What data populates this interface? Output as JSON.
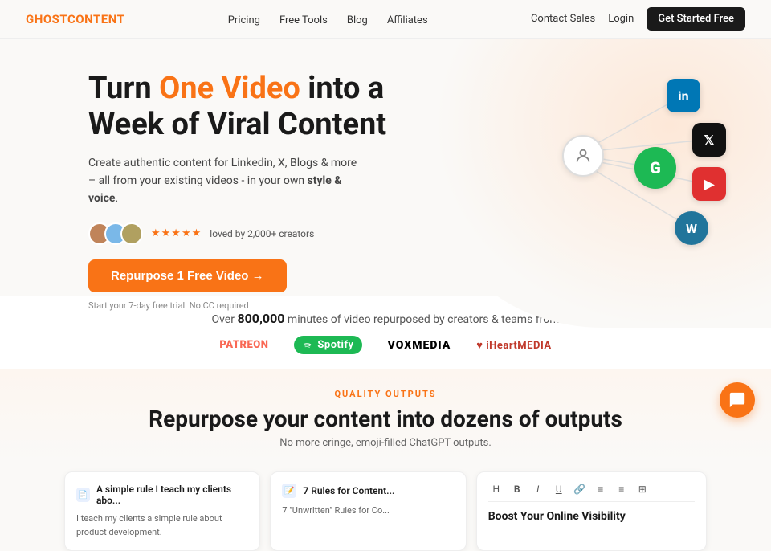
{
  "brand": {
    "logo_ghost": "GHOST",
    "logo_content": "CONTENT"
  },
  "navbar": {
    "pricing": "Pricing",
    "free_tools": "Free Tools",
    "blog": "Blog",
    "affiliates": "Affiliates",
    "contact_sales": "Contact Sales",
    "login": "Login",
    "get_started": "Get Started Free"
  },
  "hero": {
    "title_start": "Turn ",
    "title_highlight": "One Video",
    "title_end": " into a Week of Viral Content",
    "subtitle": "Create authentic content for Linkedin, X, Blogs & more – all from your existing videos - in your own ",
    "subtitle_bold": "style & voice",
    "subtitle_period": ".",
    "stars": "★★★★★",
    "social_proof": "loved by 2,000+ creators",
    "cta_button": "Repurpose 1 Free Video →",
    "trial_text": "Start your 7-day free trial. No CC required"
  },
  "stats": {
    "prefix": "Over ",
    "number": "800,000",
    "suffix": " minutes of video repurposed by creators & teams from"
  },
  "brands": [
    {
      "name": "Patreon",
      "display": "PATREON"
    },
    {
      "name": "Spotify",
      "display": "Spotify"
    },
    {
      "name": "VoxMedia",
      "display": "VOXMEDIA"
    },
    {
      "name": "iHeartMedia",
      "display": "iHeartMEDIA"
    }
  ],
  "quality_section": {
    "label": "QUALITY OUTPUTS",
    "title": "Repurpose your content into dozens of outputs",
    "subtitle": "No more cringe, emoji-filled ChatGPT outputs."
  },
  "cards": [
    {
      "icon": "📄",
      "title": "A simple rule I teach my clients abo...",
      "content": "I teach my clients a simple rule about product development."
    },
    {
      "icon": "📝",
      "title": "7 Rules for Content...",
      "content": "7 \"Unwritten\" Rules for Co..."
    }
  ],
  "editor": {
    "tools": [
      "H",
      "B",
      "I",
      "U",
      "🔗",
      "≡",
      "≡",
      "⊞"
    ],
    "title": "Boost Your Online Visibility"
  },
  "nodes": {
    "center": "👤",
    "grammarly": "G",
    "linkedin": "in",
    "twitter": "𝕏",
    "youtube": "▶",
    "wordpress": "W"
  }
}
